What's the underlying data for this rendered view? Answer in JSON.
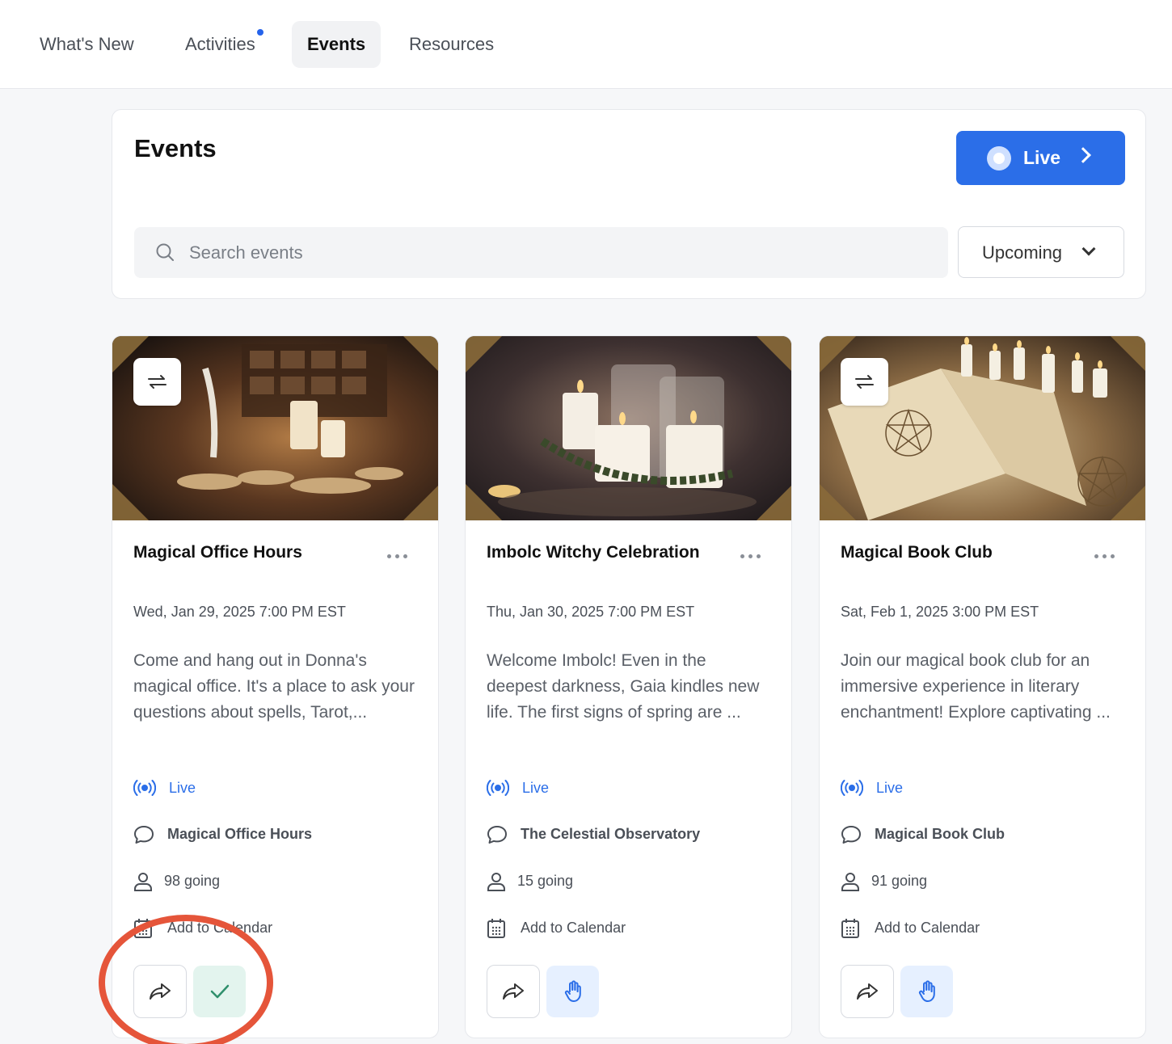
{
  "nav": {
    "tabs": [
      {
        "label": "What's New"
      },
      {
        "label": "Activities",
        "has_dot": true
      },
      {
        "label": "Events",
        "active": true
      },
      {
        "label": "Resources"
      }
    ]
  },
  "header": {
    "title": "Events",
    "live_button": "Live",
    "search_placeholder": "Search events",
    "filter_value": "Upcoming"
  },
  "events": [
    {
      "title": "Magical Office Hours",
      "date": "Wed, Jan 29, 2025 7:00 PM EST",
      "description": "Come and hang out in Donna's magical office. It's a place to ask your questions about spells, Tarot,...",
      "status": "Live",
      "space": "Magical Office Hours",
      "going": "98 going",
      "calendar": "Add to Calendar",
      "recurring": true,
      "rsvp_state": "going"
    },
    {
      "title": "Imbolc Witchy Celebration",
      "date": "Thu, Jan 30, 2025 7:00 PM EST",
      "description": "Welcome Imbolc! Even in the deepest darkness, Gaia kindles new life. The first signs of spring are ...",
      "status": "Live",
      "space": "The Celestial Observatory",
      "going": "15 going",
      "calendar": "Add to Calendar",
      "recurring": false,
      "rsvp_state": "hand"
    },
    {
      "title": "Magical Book Club",
      "date": "Sat, Feb 1, 2025 3:00 PM EST",
      "description": "Join our magical book club for an immersive experience in literary enchantment! Explore captivating ...",
      "status": "Live",
      "space": "Magical Book Club",
      "going": "91 going",
      "calendar": "Add to Calendar",
      "recurring": true,
      "rsvp_state": "hand"
    }
  ],
  "colors": {
    "accent": "#2b6ee8",
    "annotation": "#e5553a",
    "going_bg": "#e3f4ee",
    "going_check": "#2f8f6c"
  }
}
